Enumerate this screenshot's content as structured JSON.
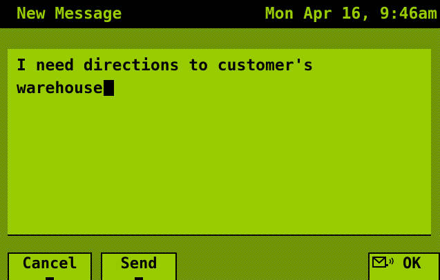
{
  "titlebar": {
    "title": "New Message",
    "clock": "Mon Apr 16, 9:46am"
  },
  "compose": {
    "message": "I need directions to customer's\nwarehouse"
  },
  "softkeys": {
    "cancel_label": "Cancel",
    "send_label": "Send",
    "ok_label": "OK",
    "ok_icon": "envelope-send-icon"
  },
  "colors": {
    "screen": "#99cc00",
    "ink": "#000000"
  }
}
